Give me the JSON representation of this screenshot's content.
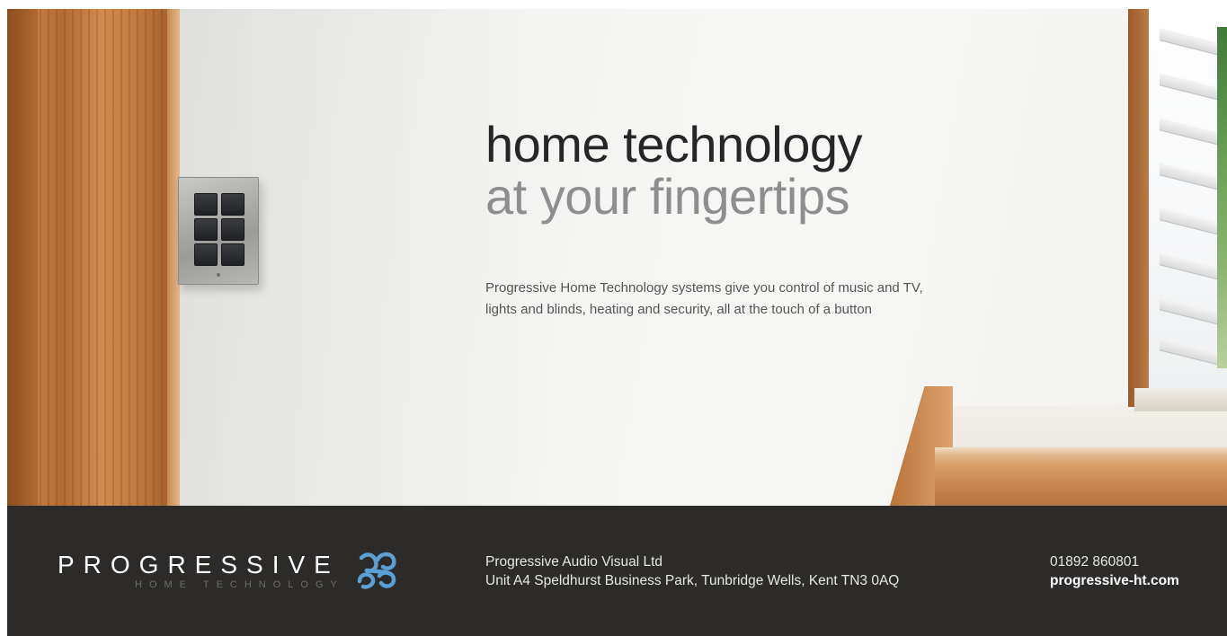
{
  "hero": {
    "headline_line1": "home technology",
    "headline_line2": "at your fingertips",
    "body_line1": "Progressive Home Technology systems give you control of music and TV,",
    "body_line2": "lights and blinds, heating and security, all at the touch of a button"
  },
  "footer": {
    "logo_word": "PROGRESSIVE",
    "logo_sub": "HOME TECHNOLOGY",
    "company_name": "Progressive Audio Visual Ltd",
    "address": "Unit A4 Speldhurst Business Park, Tunbridge Wells, Kent TN3 0AQ",
    "phone": "01892 860801",
    "website": "progressive-ht.com"
  },
  "colors": {
    "footer_bg": "#2c2b2a",
    "headline_dark": "#262626",
    "headline_light": "#8e8e8e",
    "logo_mark": "#5b9fd3"
  },
  "icons": {
    "logo_mark": "progressive-knot-logo-icon",
    "keypad": "wall-keypad-illustration"
  }
}
